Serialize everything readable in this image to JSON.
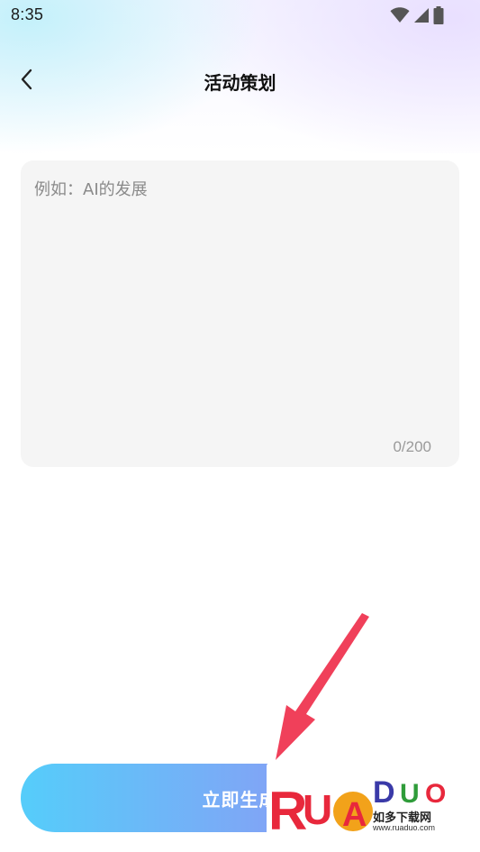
{
  "status_bar": {
    "time": "8:35",
    "icons": [
      "wifi-icon",
      "signal-icon",
      "battery-icon"
    ]
  },
  "header": {
    "back_icon": "chevron-left-icon",
    "title": "活动策划"
  },
  "editor": {
    "placeholder": "例如：AI的发展",
    "value": "",
    "counter": "0/200"
  },
  "actions": {
    "generate_label": "立即生成"
  },
  "watermark": {
    "logo_text": "RUADUO",
    "subtitle": "如多下载网",
    "url": "www.ruaduo.com"
  },
  "colors": {
    "button_gradient_start": "#55cdfa",
    "button_gradient_end": "#a37df3",
    "annotation_arrow": "#f0405a",
    "panel_bg": "#f5f5f5"
  }
}
